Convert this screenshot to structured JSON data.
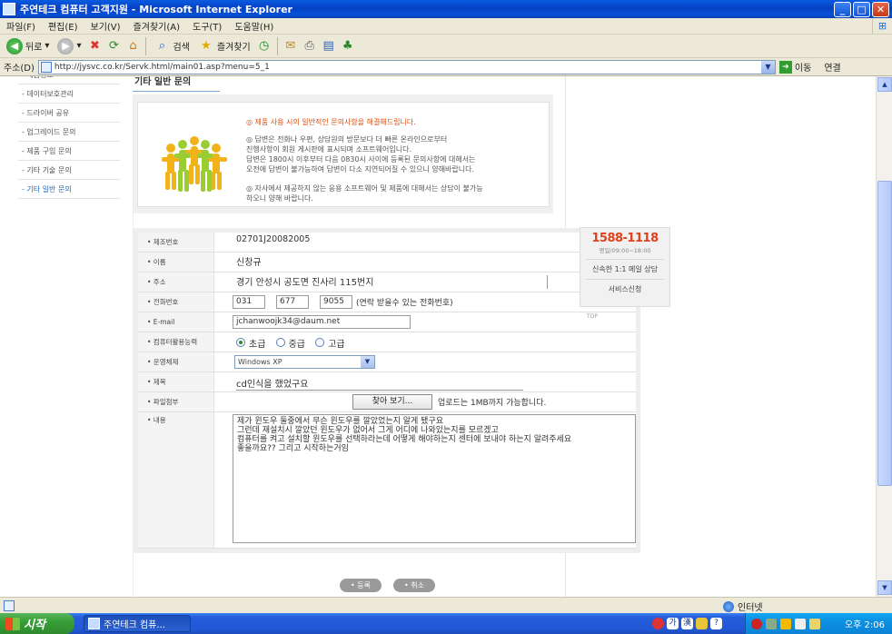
{
  "window": {
    "title": "주연테크 컴퓨터 고객지원 - Microsoft Internet Explorer",
    "controls": [
      "_",
      "□",
      "✕"
    ]
  },
  "menu": [
    "파일(F)",
    "편집(E)",
    "보기(V)",
    "즐겨찾기(A)",
    "도구(T)",
    "도움말(H)"
  ],
  "toolbar": {
    "back_label": "뒤로",
    "search_label": "검색",
    "favorites_label": "즐겨찾기"
  },
  "address": {
    "label": "주소(D)",
    "url": "http://jysvc.co.kr/Servk.html/main01.asp?menu=5_1",
    "go_label": "이동",
    "links_label": "연결"
  },
  "leftnav": {
    "items": [
      {
        "label": "- 제품정보"
      },
      {
        "label": "- 데이터보호관리"
      },
      {
        "label": "- 드라이버 공유"
      },
      {
        "label": "- 업그레이드 문의"
      },
      {
        "label": "- 제품 구입 문의"
      },
      {
        "label": "- 기타 기술 문의"
      },
      {
        "label": "- 기타 일반 문의",
        "active": true
      }
    ]
  },
  "section": {
    "title": "기타 일반 문의"
  },
  "notice": {
    "lines": [
      "◎ 제품 사용 시의 일반적인 문의사항을 해결해드립니다.",
      "◎ 답변은 전화나 우편, 상담원의 방문보다 더 빠른 온라인으로부터",
      "   진행사항이 회원 게시판에 표시되며 소프트웨어입니다.",
      "   답변은 1800시 이후부터 다음 0830시 사이에 등록된 문의사항에 대해서는",
      "   오전에 답변이 불가능하여 답변이 다소 지연되어질 수 있으니 양해바랍니다.",
      "◎ 자사에서 제공하지 않는 응용 소프트웨어 및 제품에 대해서는 상담이 불가능",
      "   하오니 양해 바랍니다."
    ]
  },
  "form": {
    "rows": {
      "product_no": {
        "label": "• 제조번호",
        "value": "02701J20082005"
      },
      "name": {
        "label": "• 이름",
        "value": "신창규"
      },
      "address": {
        "label": "• 주소",
        "value": "경기 안성시 공도면 진사리 115번지"
      },
      "phone": {
        "label": "• 전화번호",
        "p1": "031",
        "p2": "677",
        "p3": "9055",
        "note": "(연락 받을수 있는 전화번호)"
      },
      "email": {
        "label": "• E-mail",
        "value": "jchanwoojk34@daum.net"
      },
      "skill": {
        "label": "• 컴퓨터활용능력",
        "options": [
          "초급",
          "중급",
          "고급"
        ],
        "selected": "초급"
      },
      "os": {
        "label": "• 운영체제",
        "value": "Windows XP"
      },
      "subject": {
        "label": "• 제목",
        "value": "cd인식을 했었구요"
      },
      "attachment": {
        "label": "• 파일첨부",
        "button": "찾아 보기...",
        "note": "업로드는 1MB까지 가능합니다."
      },
      "content": {
        "label": "• 내용",
        "value": "제가 윈도우 둘중에서 무슨 윈도우를 깔았었는지 알게 됐구요\n그런데 재설치시 깔았던 윈도우가 없어서 그게 어디에 나와있는지를 모르겠고\n컴퓨터를 켜고 설치할 윈도우를 선택하라는데 어떻게 해야하는지 센터에 보내야 하는지 알려주세요\n좋을까요?? 그리고 시작하는거임"
      }
    }
  },
  "float_box": {
    "phone": "1588-1118",
    "hours": "평일/09:00~18:00",
    "chat_label": "신속한 1:1 메일 상담",
    "request_label": "서비스신청",
    "top_label": "TOP"
  },
  "buttons": {
    "submit": "• 등록",
    "cancel": "• 취소"
  },
  "statusbar": {
    "zone": "인터넷"
  },
  "taskbar": {
    "start": "시작",
    "task": "주연테크 컴퓨...",
    "clock": "오후 2:06"
  }
}
